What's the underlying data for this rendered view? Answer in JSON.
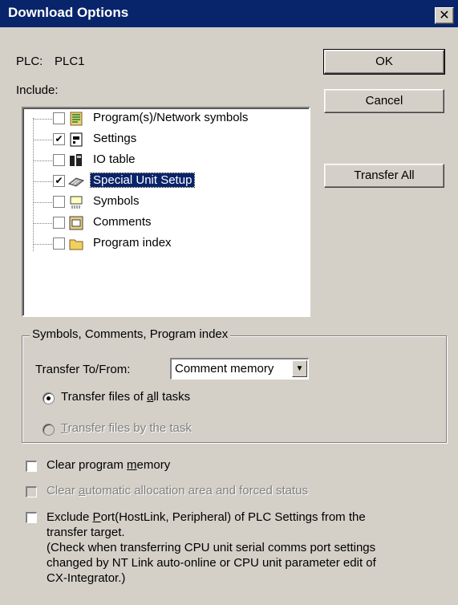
{
  "window": {
    "title": "Download Options",
    "close_glyph": "✕"
  },
  "plc": {
    "label": "PLC:",
    "value": "PLC1"
  },
  "include_label": "Include:",
  "tree": {
    "items": [
      {
        "label": "Program(s)/Network symbols",
        "checked": false,
        "icon": "program-icon"
      },
      {
        "label": "Settings",
        "checked": true,
        "icon": "settings-icon"
      },
      {
        "label": "IO table",
        "checked": false,
        "icon": "io-table-icon"
      },
      {
        "label": "Special Unit Setup",
        "checked": true,
        "icon": "special-unit-icon",
        "selected": true
      },
      {
        "label": "Symbols",
        "checked": false,
        "icon": "symbols-icon"
      },
      {
        "label": "Comments",
        "checked": false,
        "icon": "comments-icon"
      },
      {
        "label": "Program index",
        "checked": false,
        "icon": "folder-icon"
      }
    ],
    "check_glyph": "✔"
  },
  "buttons": {
    "ok": "OK",
    "cancel": "Cancel",
    "transfer_all": "Transfer All"
  },
  "group": {
    "title": "Symbols, Comments, Program index",
    "transfer_label": "Transfer To/From:",
    "select_value": "Comment memory",
    "select_arrow": "▼",
    "radio_all_prefix": "Transfer files of ",
    "radio_all_key": "a",
    "radio_all_suffix": "ll tasks",
    "radio_task_key": "T",
    "radio_task_suffix": "ransfer files by the task"
  },
  "options": {
    "clear_memory_prefix": "Clear program ",
    "clear_memory_key": "m",
    "clear_memory_suffix": "emory",
    "clear_auto_prefix": "Clear ",
    "clear_auto_key": "a",
    "clear_auto_suffix": "utomatic allocation area and forced status",
    "exclude_prefix": "Exclude ",
    "exclude_key": "P",
    "exclude_line1_rest": "ort(HostLink, Peripheral) of PLC Settings from the",
    "exclude_line2": "transfer target.",
    "exclude_line3": "(Check when transferring CPU unit serial comms port settings",
    "exclude_line4": "changed by NT Link auto-online or CPU unit parameter edit of",
    "exclude_line5": "CX-Integrator.)"
  }
}
